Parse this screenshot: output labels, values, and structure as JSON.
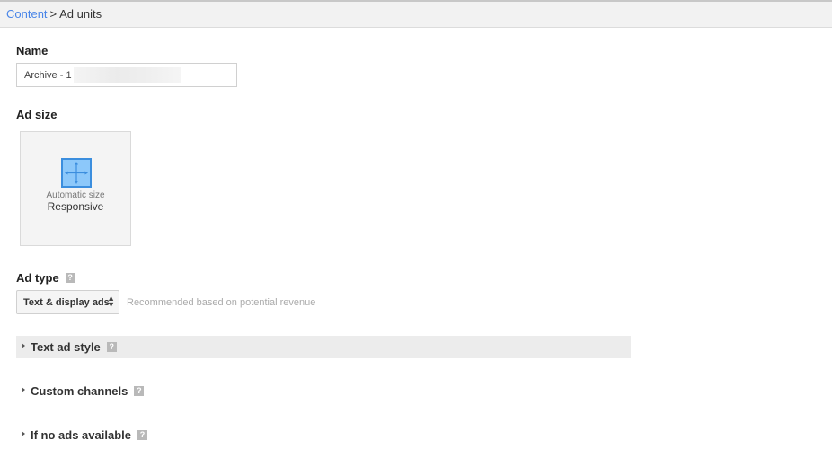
{
  "breadcrumb": {
    "parent": "Content",
    "separator": ">",
    "current": "Ad units"
  },
  "name": {
    "label": "Name",
    "value": "Archive - 1"
  },
  "ad_size": {
    "label": "Ad size",
    "card": {
      "icon": "resize-arrows-icon",
      "subtitle": "Automatic size",
      "title": "Responsive"
    }
  },
  "ad_type": {
    "label": "Ad type",
    "help": "?",
    "selected": "Text & display ads",
    "hint": "Recommended based on potential revenue"
  },
  "sections": [
    {
      "label": "Text ad style",
      "help": "?"
    },
    {
      "label": "Custom channels",
      "help": "?"
    },
    {
      "label": "If no ads available",
      "help": "?"
    }
  ],
  "colors": {
    "link": "#4a86e8",
    "icon_fill": "#8cc8fa",
    "icon_border": "#3b8ede"
  }
}
